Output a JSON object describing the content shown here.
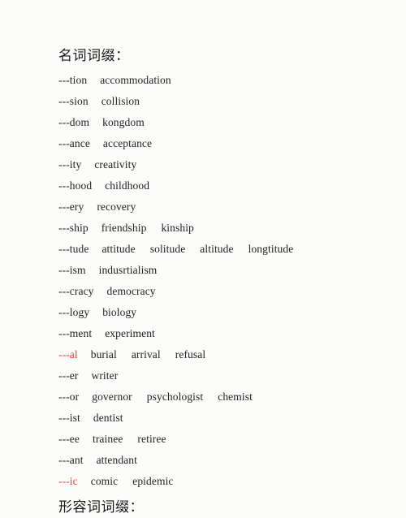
{
  "document": {
    "background_color": "#fcfdfa",
    "text_color": "#222222",
    "highlight_color": "#ef3b30"
  },
  "noun_section": {
    "heading": "名词词缀：",
    "rows": [
      {
        "suffix": "---tion",
        "highlighted": false,
        "words": [
          "accommodation"
        ]
      },
      {
        "suffix": "---sion",
        "highlighted": false,
        "words": [
          "collision"
        ]
      },
      {
        "suffix": "---dom",
        "highlighted": false,
        "words": [
          "kongdom"
        ]
      },
      {
        "suffix": "---ance",
        "highlighted": false,
        "words": [
          "acceptance"
        ]
      },
      {
        "suffix": "---ity",
        "highlighted": false,
        "words": [
          "creativity"
        ]
      },
      {
        "suffix": "---hood",
        "highlighted": false,
        "words": [
          "childhood"
        ]
      },
      {
        "suffix": "---ery",
        "highlighted": false,
        "words": [
          "recovery"
        ]
      },
      {
        "suffix": "---ship",
        "highlighted": false,
        "words": [
          "friendship",
          "kinship"
        ]
      },
      {
        "suffix": "---tude",
        "highlighted": false,
        "words": [
          "attitude",
          "solitude",
          "altitude",
          "longtitude"
        ]
      },
      {
        "suffix": "---ism",
        "highlighted": false,
        "words": [
          "indusrtialism"
        ]
      },
      {
        "suffix": "---cracy",
        "highlighted": false,
        "words": [
          "democracy"
        ]
      },
      {
        "suffix": "---logy",
        "highlighted": false,
        "words": [
          "biology"
        ]
      },
      {
        "suffix": "---ment",
        "highlighted": false,
        "words": [
          "experiment"
        ]
      },
      {
        "suffix": "---al",
        "highlighted": true,
        "words": [
          "burial",
          "arrival",
          "refusal"
        ]
      },
      {
        "suffix": "---er",
        "highlighted": false,
        "words": [
          "writer"
        ]
      },
      {
        "suffix": "---or",
        "highlighted": false,
        "words": [
          "governor",
          "psychologist",
          "chemist"
        ]
      },
      {
        "suffix": "---ist",
        "highlighted": false,
        "words": [
          "dentist"
        ]
      },
      {
        "suffix": "---ee",
        "highlighted": false,
        "words": [
          "trainee",
          "retiree"
        ]
      },
      {
        "suffix": "---ant",
        "highlighted": false,
        "words": [
          "attendant"
        ]
      },
      {
        "suffix": "---ic",
        "highlighted": true,
        "words": [
          "comic",
          "epidemic"
        ]
      }
    ]
  },
  "adjective_section": {
    "heading": "形容词词缀："
  }
}
